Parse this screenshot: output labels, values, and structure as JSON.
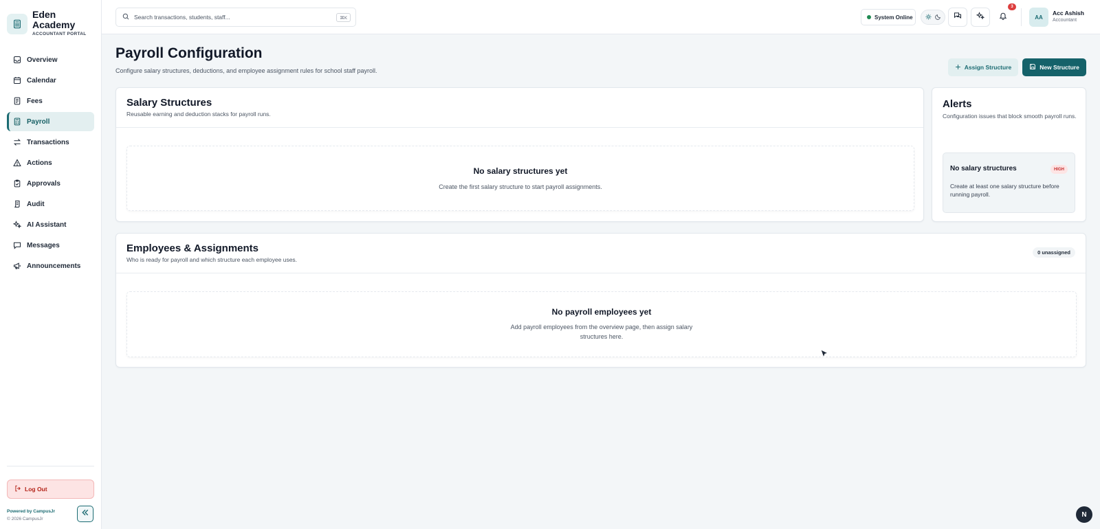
{
  "brand": {
    "name": "Eden Academy",
    "portal": "ACCOUNTANT PORTAL"
  },
  "sidebar": {
    "items": [
      {
        "label": "Overview",
        "icon": "inbox-icon"
      },
      {
        "label": "Calendar",
        "icon": "calendar-icon"
      },
      {
        "label": "Fees",
        "icon": "receipt-icon"
      },
      {
        "label": "Payroll",
        "icon": "calculator-icon",
        "active": true
      },
      {
        "label": "Transactions",
        "icon": "arrows-swap-icon"
      },
      {
        "label": "Actions",
        "icon": "warning-icon"
      },
      {
        "label": "Approvals",
        "icon": "clipboard-check-icon"
      },
      {
        "label": "Audit",
        "icon": "scroll-icon"
      },
      {
        "label": "AI Assistant",
        "icon": "sparkles-icon"
      },
      {
        "label": "Messages",
        "icon": "chat-icon"
      },
      {
        "label": "Announcements",
        "icon": "megaphone-icon"
      }
    ],
    "logout_label": "Log Out",
    "powered_by": "Powered by CampusJr",
    "copyright": "© 2026 CampusJr"
  },
  "topbar": {
    "search_placeholder": "Search transactions, students, staff...",
    "shortcut": "⌘K",
    "system_status": "System Online",
    "notification_count": "3",
    "user": {
      "initials": "AA",
      "name": "Acc Ashish",
      "role": "Accountant"
    }
  },
  "page": {
    "title": "Payroll Configuration",
    "subtitle": "Configure salary structures, deductions, and employee assignment rules for school staff payroll.",
    "assign_button": "Assign Structure",
    "new_button": "New Structure"
  },
  "salary_structures": {
    "title": "Salary Structures",
    "subtitle": "Reusable earning and deduction stacks for payroll runs.",
    "empty_title": "No salary structures yet",
    "empty_desc": "Create the first salary structure to start payroll assignments."
  },
  "alerts": {
    "title": "Alerts",
    "subtitle": "Configuration issues that block smooth payroll runs.",
    "items": [
      {
        "title": "No salary structures",
        "severity": "HIGH",
        "desc": "Create at least one salary structure before running payroll."
      }
    ]
  },
  "employees": {
    "title": "Employees & Assignments",
    "subtitle": "Who is ready for payroll and which structure each employee uses.",
    "unassigned_badge": "0 unassigned",
    "empty_title": "No payroll employees yet",
    "empty_desc_line1": "Add payroll employees from the overview page, then assign salary",
    "empty_desc_line2": "structures here."
  },
  "fab_label": "N",
  "colors": {
    "accent": "#15626a",
    "accent_light": "#e2eff0",
    "danger": "#c53030",
    "online": "#1f8a52"
  }
}
